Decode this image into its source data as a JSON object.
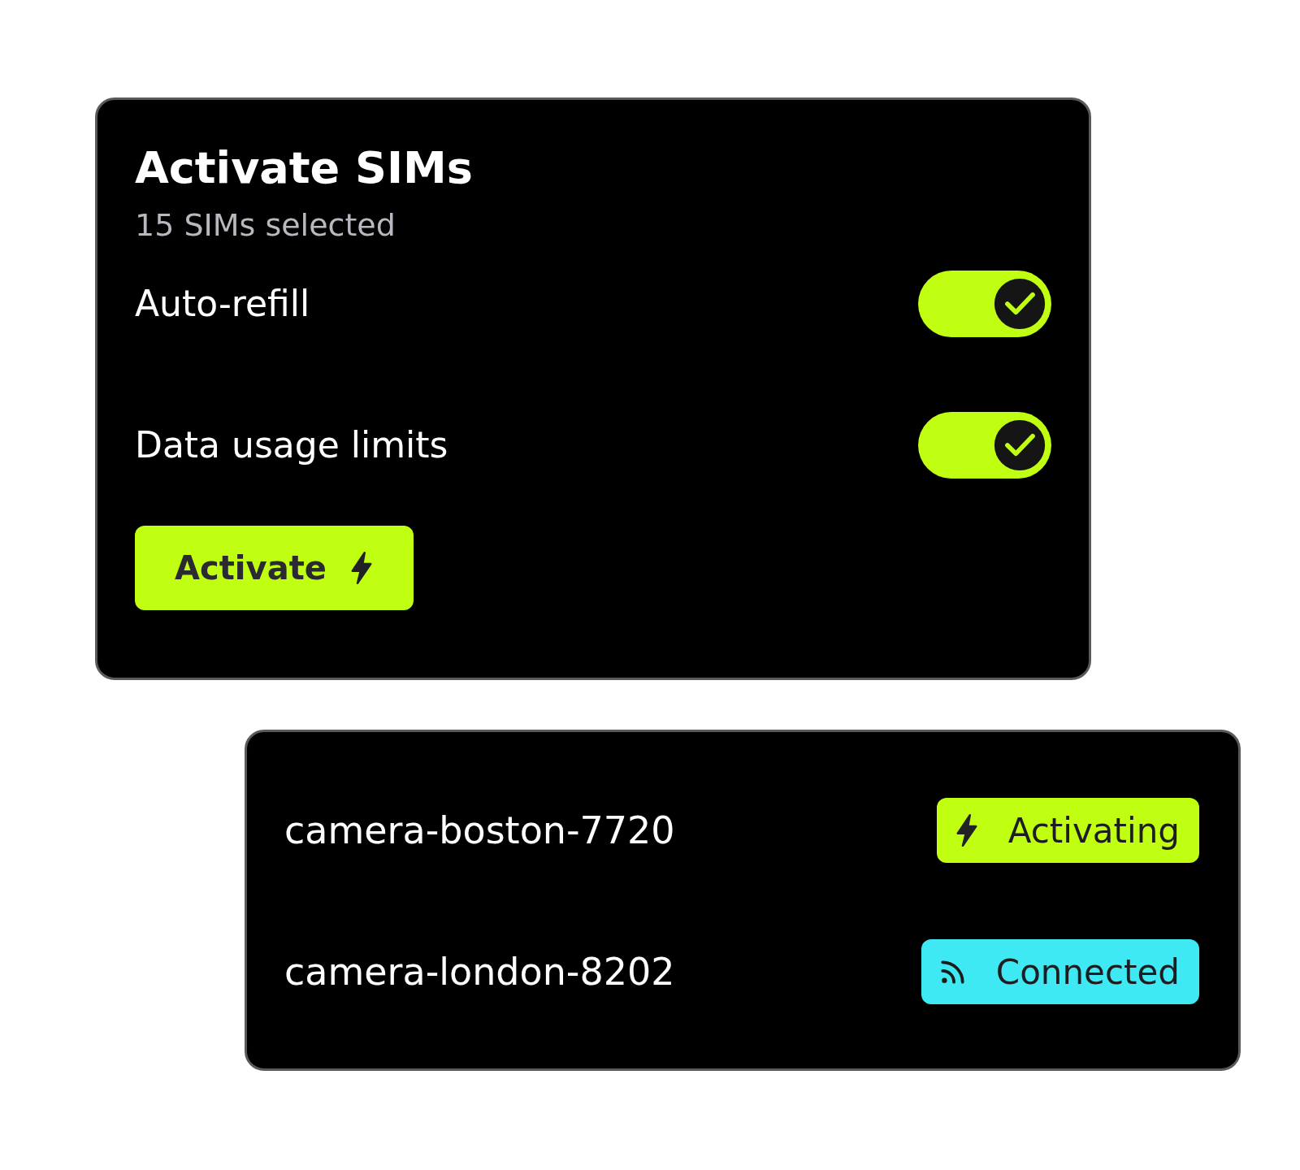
{
  "activation_card": {
    "title": "Activate SIMs",
    "subtitle": "15 SIMs selected",
    "settings": [
      {
        "label": "Auto-refill",
        "on": true
      },
      {
        "label": "Data usage limits",
        "on": true
      }
    ],
    "button": {
      "label": "Activate"
    }
  },
  "devices": [
    {
      "name": "camera-boston-7720",
      "status": {
        "kind": "activating",
        "label": "Activating",
        "color": "#c0ff12"
      }
    },
    {
      "name": "camera-london-8202",
      "status": {
        "kind": "connected",
        "label": "Connected",
        "color": "#3ee9f3"
      }
    }
  ]
}
